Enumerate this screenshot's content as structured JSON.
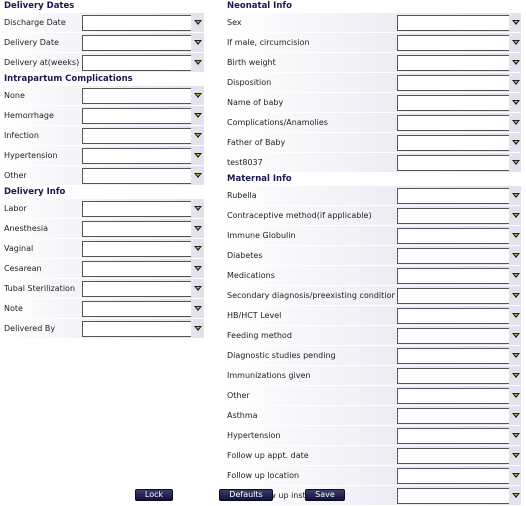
{
  "delivery_dates": {
    "title": "Delivery Dates",
    "rows": [
      "Discharge Date",
      "Delivery Date",
      "Delivery at(weeks)"
    ]
  },
  "intrapartum": {
    "title": "Intrapartum Complications",
    "rows": [
      "None",
      "Hemorrhage",
      "Infection",
      "Hypertension",
      "Other"
    ]
  },
  "delivery_info": {
    "title": "Delivery Info",
    "rows": [
      "Labor",
      "Anesthesia",
      "Vaginal",
      "Cesarean",
      "Tubal Sterilization",
      "Note",
      "Delivered By"
    ]
  },
  "neonatal": {
    "title": "Neonatal Info",
    "rows": [
      "Sex",
      "If male, circumcision",
      "Birth weight",
      "Disposition",
      "Name of baby",
      "Complications/Anamolies",
      "Father of Baby",
      "test8037"
    ]
  },
  "maternal": {
    "title": "Maternal Info",
    "rows": [
      "Rubella",
      "Contraceptive method(if applicable)",
      "Immune Globulin",
      "Diabetes",
      "Medications",
      "Secondary diagnosis/preexisting conditions",
      "HB/HCT Level",
      "Feeding method",
      "Diagnostic studies pending",
      "Immunizations given",
      "Other",
      "Asthma",
      "Hypertension",
      "Follow up appt. date",
      "Follow up location",
      "Other follow up instructions"
    ]
  },
  "buttons": {
    "lock": "Lock",
    "defaults": "Defaults",
    "save": "Save"
  },
  "icons": {
    "dropdown": "dropdown-arrow-icon"
  }
}
